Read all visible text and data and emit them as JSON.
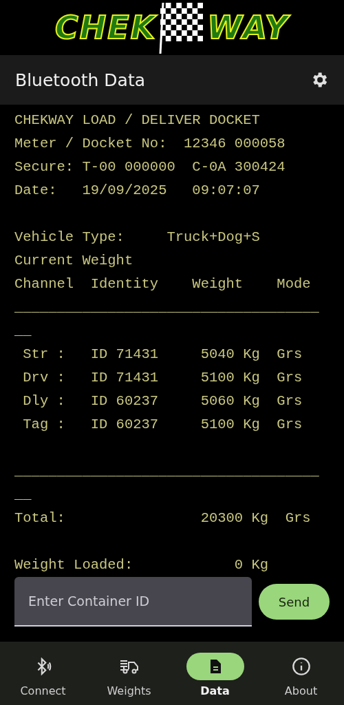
{
  "logo": {
    "left": "CHEK",
    "right": "WAY"
  },
  "app_bar": {
    "title": "Bluetooth Data"
  },
  "docket": [
    {
      "kind": "text",
      "text": "CHEKWAY LOAD / DELIVER DOCKET"
    },
    {
      "kind": "text",
      "text": "Meter / Docket No:  12346 000058"
    },
    {
      "kind": "text",
      "text": "Secure: T-00 000000  C-0A 300424"
    },
    {
      "kind": "text",
      "text": "Date:   19/09/2025   09:07:07"
    },
    {
      "kind": "blank"
    },
    {
      "kind": "text",
      "text": "Vehicle Type:     Truck+Dog+S"
    },
    {
      "kind": "text",
      "text": "Current Weight"
    },
    {
      "kind": "text",
      "text": "Channel  Identity    Weight    Mode"
    },
    {
      "kind": "text",
      "text": "____________________________________"
    },
    {
      "kind": "text",
      "text": "__"
    },
    {
      "kind": "text",
      "text": " Str :   ID 71431     5040 Kg  Grs"
    },
    {
      "kind": "text",
      "text": " Drv :   ID 71431     5100 Kg  Grs"
    },
    {
      "kind": "text",
      "text": " Dly :   ID 60237     5060 Kg  Grs"
    },
    {
      "kind": "text",
      "text": " Tag :   ID 60237     5100 Kg  Grs"
    },
    {
      "kind": "blank"
    },
    {
      "kind": "text",
      "text": "____________________________________"
    },
    {
      "kind": "text",
      "text": "__"
    },
    {
      "kind": "text",
      "text": "Total:                20300 Kg  Grs"
    },
    {
      "kind": "blank"
    },
    {
      "kind": "text",
      "text": "Weight Loaded:            0 Kg"
    }
  ],
  "container_field": {
    "placeholder": "Enter Container ID"
  },
  "send_button": "Send",
  "nav": [
    {
      "label": "Connect",
      "selected": false
    },
    {
      "label": "Weights",
      "selected": false
    },
    {
      "label": "Data",
      "selected": true
    },
    {
      "label": "About",
      "selected": false
    }
  ]
}
